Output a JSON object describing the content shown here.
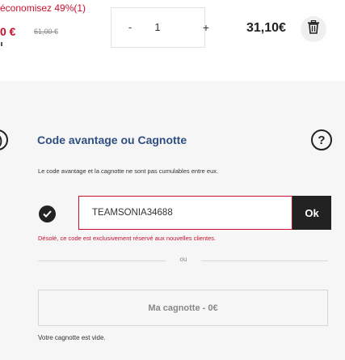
{
  "product": {
    "savings_text": "économisez 49%(1)",
    "price_now": "0 €",
    "price_old": "61,00 €",
    "quantity": "1",
    "minus_label": "-",
    "plus_label": "+",
    "line_total": "31,10€"
  },
  "promo": {
    "left_icon_glyph": "?)",
    "title": "Code avantage ou Cagnotte",
    "help_glyph": "?",
    "note": "Le code avantage et la cagnotte ne sont pas cumulables entre eux.",
    "code_value": "TEAMSONIA34688",
    "ok_label": "Ok",
    "error": "Désolé, ce code est exclusivement réservé aux nouvelles clientes.",
    "or_label": "ou",
    "cagnotte_button": "Ma cagnotte - 0€",
    "empty_message": "Votre cagnotte est vide."
  },
  "icons": {
    "delete": "trash-icon",
    "applied": "check-circle-icon",
    "help": "help-icon"
  },
  "colors": {
    "accent_red": "#c8102e",
    "title_blue": "#2e4f80",
    "dark": "#222222"
  }
}
